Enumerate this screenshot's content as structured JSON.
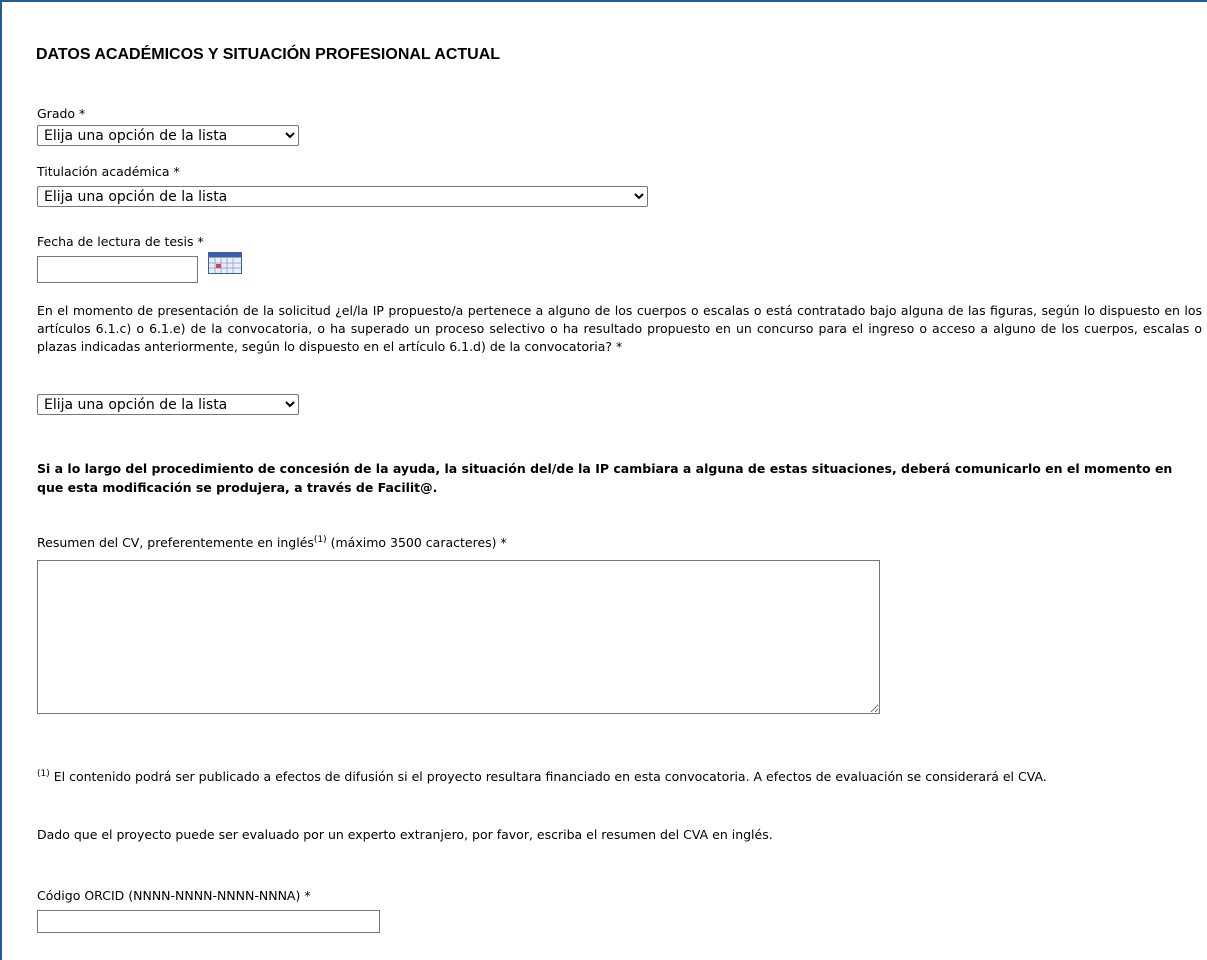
{
  "section": {
    "title": "DATOS ACADÉMICOS Y SITUACIÓN PROFESIONAL ACTUAL"
  },
  "grado": {
    "label": "Grado *",
    "selected": "Elija una opción de la lista"
  },
  "titulacion": {
    "label": "Titulación académica *",
    "selected": "Elija una opción de la lista"
  },
  "fecha_tesis": {
    "label": "Fecha de lectura de tesis *",
    "value": "",
    "calendar_icon": "calendar-icon"
  },
  "pertenencia": {
    "question": "En el momento de presentación de la solicitud ¿el/la IP propuesto/a pertenece a alguno de los cuerpos o escalas o está contratado bajo alguna de las figuras, según lo dispuesto en los artículos 6.1.c) o 6.1.e) de la convocatoria, o ha superado un proceso selectivo o ha resultado propuesto en un concurso para el ingreso o acceso a alguno de los cuerpos, escalas o plazas indicadas anteriormente, según lo dispuesto en el artículo 6.1.d) de la convocatoria? *",
    "selected": "Elija una opción de la lista"
  },
  "aviso": {
    "text": "Si a lo largo del procedimiento de concesión de la ayuda, la situación del/de la IP cambiara a alguna de estas situaciones, deberá comunicarlo en el momento en que esta modificación se produjera, a través de Facilit@."
  },
  "resumen_cv": {
    "label_prefix": "Resumen del CV, preferentemente en inglés",
    "label_sup": "(1)",
    "label_suffix": " (máximo 3500 caracteres)  *",
    "value": ""
  },
  "nota": {
    "sup": "(1)",
    "text": " El contenido podrá ser publicado a efectos de difusión si el proyecto resultara financiado en esta convocatoria. A efectos de evaluación se considerará el CVA.",
    "text2": "Dado que el proyecto puede ser evaluado por un experto extranjero, por favor, escriba el resumen del CVA en inglés."
  },
  "orcid": {
    "label": "Código ORCID (NNNN-NNNN-NNNN-NNNA) *",
    "value": ""
  },
  "colors": {
    "frame": "#1f5f94",
    "calendar_header": "#3a5fa8",
    "calendar_mark": "#c0504d"
  }
}
